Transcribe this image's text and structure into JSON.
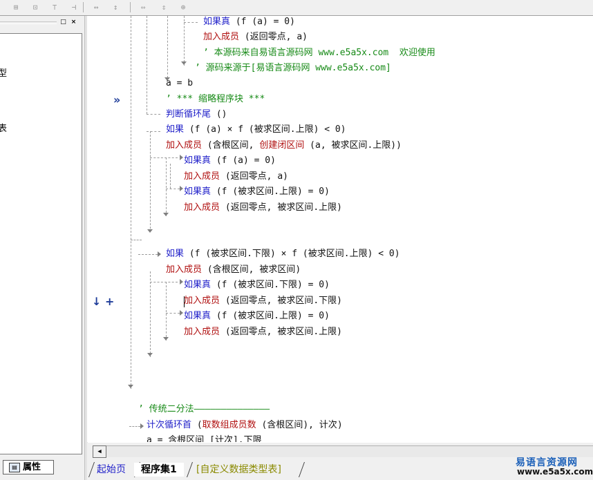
{
  "toolbar": {
    "buttons": [
      {
        "icon": "align-left-icon"
      },
      {
        "icon": "align-center-icon"
      },
      {
        "icon": "align-top-icon"
      },
      {
        "icon": "align-middle-icon"
      },
      {
        "icon": "same-width-icon"
      },
      {
        "icon": "same-height-icon"
      },
      {
        "icon": "horizontal-space-icon"
      },
      {
        "icon": "vertical-space-icon"
      },
      {
        "icon": "center-in-form-icon"
      }
    ]
  },
  "left_panel": {
    "partial_texts": [
      "型",
      "表"
    ],
    "tab_label": "属性"
  },
  "margin_icons": {
    "breakpoint": "»",
    "step_down": "↓",
    "expand": "+"
  },
  "code_lines": [
    [
      {
        "t": "如果真",
        "c": "kw"
      },
      {
        "t": " (f (a) = 0)",
        "c": "tx"
      }
    ],
    [
      {
        "t": "加入成员",
        "c": "cmd"
      },
      {
        "t": " (返回零点, a)",
        "c": "tx"
      }
    ],
    [
      {
        "t": "’ 本源码来自易语言源码网 www.e5a5x.com  欢迎使用",
        "c": "cm"
      }
    ],
    [
      {
        "t": "’ 源码来源于[易语言源码网 www.e5a5x.com]",
        "c": "cm"
      }
    ],
    [
      {
        "t": "a = b",
        "c": "tx"
      }
    ],
    [
      {
        "t": "’ *** 缩略程序块 ***",
        "c": "cm"
      }
    ],
    [
      {
        "t": "判断循环尾",
        "c": "kw"
      },
      {
        "t": " ()",
        "c": "tx"
      }
    ],
    [
      {
        "t": "如果",
        "c": "kw"
      },
      {
        "t": " (f (a) × f (被求区间.上限) < 0)",
        "c": "tx"
      }
    ],
    [
      {
        "t": "加入成员",
        "c": "cmd"
      },
      {
        "t": " (含根区间, ",
        "c": "tx"
      },
      {
        "t": "创建闭区间",
        "c": "cmd"
      },
      {
        "t": " (a, 被求区间.上限))",
        "c": "tx"
      }
    ],
    [
      {
        "t": "如果真",
        "c": "kw"
      },
      {
        "t": " (f (a) = 0)",
        "c": "tx"
      }
    ],
    [
      {
        "t": "加入成员",
        "c": "cmd"
      },
      {
        "t": " (返回零点, a)",
        "c": "tx"
      }
    ],
    [
      {
        "t": "如果真",
        "c": "kw"
      },
      {
        "t": " (f (被求区间.上限) = 0)",
        "c": "tx"
      }
    ],
    [
      {
        "t": "加入成员",
        "c": "cmd"
      },
      {
        "t": " (返回零点, 被求区间.上限)",
        "c": "tx"
      }
    ],
    [
      {
        "t": "如果",
        "c": "kw"
      },
      {
        "t": " (f (被求区间.下限) × f (被求区间.上限) < 0)",
        "c": "tx"
      }
    ],
    [
      {
        "t": "加入成员",
        "c": "cmd"
      },
      {
        "t": " (含根区间, 被求区间)",
        "c": "tx"
      }
    ],
    [
      {
        "t": "如果真",
        "c": "kw"
      },
      {
        "t": " (f (被求区间.下限) = 0)",
        "c": "tx"
      }
    ],
    [
      {
        "t": "加入成员",
        "c": "cmd"
      },
      {
        "t": " (返回零点, 被求区间.下限)",
        "c": "tx"
      }
    ],
    [
      {
        "t": "如果真",
        "c": "kw"
      },
      {
        "t": " (f (被求区间.上限) = 0)",
        "c": "tx"
      }
    ],
    [
      {
        "t": "加入成员",
        "c": "cmd"
      },
      {
        "t": " (返回零点, 被求区间.上限)",
        "c": "tx"
      }
    ],
    [
      {
        "t": "’ 传统二分法——————————————",
        "c": "cm"
      }
    ],
    [
      {
        "t": "计次循环首",
        "c": "kw"
      },
      {
        "t": " (",
        "c": "tx"
      },
      {
        "t": "取数组成员数",
        "c": "cmd"
      },
      {
        "t": " (含根区间), 计次)",
        "c": "tx"
      }
    ],
    [
      {
        "t": "a = 含根区间 [计次].下限",
        "c": "tx"
      }
    ]
  ],
  "tabs": [
    {
      "label": "起始页",
      "color": "#1f1fc9"
    },
    {
      "label": "程序集1",
      "color": "#000000"
    },
    {
      "label": "[自定义数据类型表]",
      "color": "#8a8a00"
    }
  ],
  "watermark": {
    "cn": "易语言资源网",
    "url": "www.e5a5x.com"
  }
}
